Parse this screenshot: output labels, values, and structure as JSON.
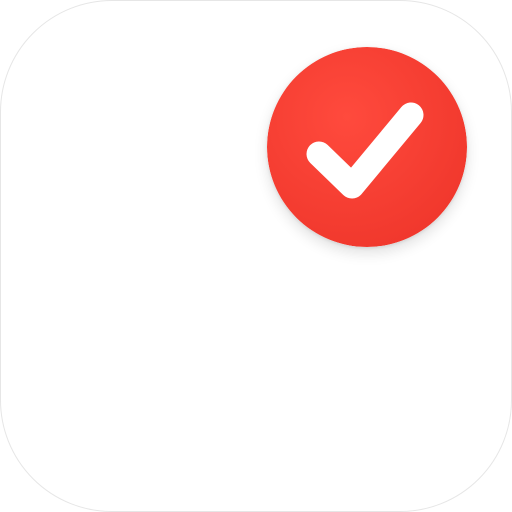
{
  "app_icon": {
    "icon_name": "app-icon",
    "background_color": "#ffffff",
    "border_color": "#e6e6e6"
  },
  "badge": {
    "icon_name": "checkmark-icon",
    "fill_color": "#ff3b30",
    "fill_color_dark": "#e8392c",
    "check_color": "#ffffff"
  }
}
